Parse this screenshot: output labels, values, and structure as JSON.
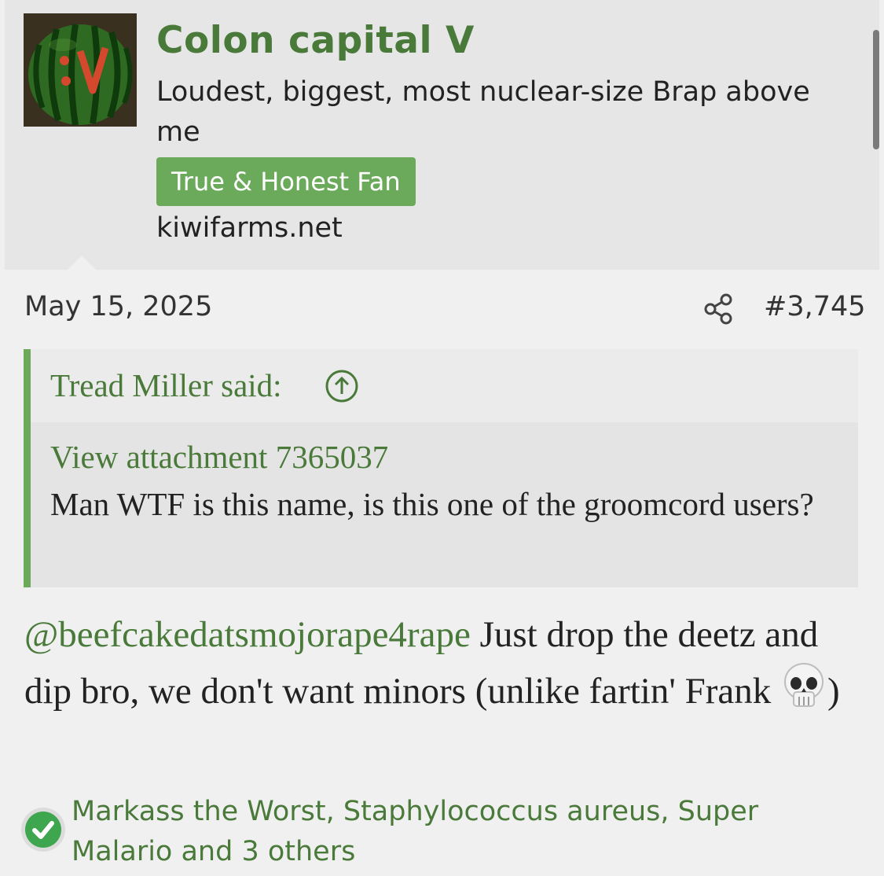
{
  "user": {
    "name": "Colon capital V",
    "title": "Loudest, biggest, most nuclear-size Brap above me",
    "banner": "True & Honest Fan",
    "site": "kiwifarms.net",
    "avatar_icon": "watermelon-avatar-icon"
  },
  "post": {
    "date": "May 15, 2025",
    "number": "#3,745",
    "share_icon": "share-icon"
  },
  "quote": {
    "author": "Tread Miller said:",
    "attachment": "View attachment 7365037",
    "text": "Man WTF is this name, is this one of the groomcord users?"
  },
  "body": {
    "mention": "@beefcakedatsmojorape4rape",
    "text": " Just drop the deetz and dip bro, we don't want minors (unlike fartin' Frank ",
    "emoji": "skull-emoji",
    "close": ")"
  },
  "reactions": {
    "text": "Markass the Worst, Staphylococcus aureus, Super Malario and 3 others",
    "icon": "checkmark-icon"
  },
  "colors": {
    "accent_green": "#4a7a3a",
    "banner_green": "#6aaa5a",
    "react_green": "#3ea64e"
  }
}
